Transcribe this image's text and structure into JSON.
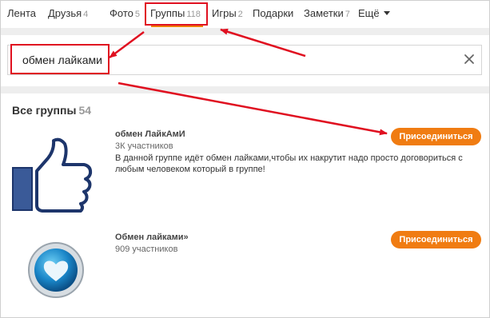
{
  "nav": {
    "items": [
      {
        "label": "Лента",
        "count": ""
      },
      {
        "label": "Друзья",
        "count": "4"
      },
      {
        "label": "Фото",
        "count": "5"
      },
      {
        "label": "Группы",
        "count": "118"
      },
      {
        "label": "Игры",
        "count": "2"
      },
      {
        "label": "Подарки",
        "count": ""
      },
      {
        "label": "Заметки",
        "count": "7"
      },
      {
        "label": "Ещё",
        "count": ""
      }
    ],
    "active_index": 3,
    "accent": "#ee8208"
  },
  "search": {
    "value": "обмен лайками",
    "clear_icon": "close-icon"
  },
  "groups": {
    "title": "Все группы",
    "count": "54",
    "items": [
      {
        "name": "обмен ЛайкАмИ",
        "members": "3К участников",
        "description": "В данной группе идёт обмен лайками,чтобы их накрутит надо просто договориться с любым человеком который в группе!",
        "join_label": "Присоединиться",
        "icon": "thumbs-up-icon"
      },
      {
        "name": "Обмен лайками»",
        "members": "909 участников",
        "description": "",
        "join_label": "Присоединиться",
        "icon": "heart-badge-icon"
      }
    ]
  },
  "colors": {
    "annotation": "#e01020",
    "button": "#f07c12"
  }
}
